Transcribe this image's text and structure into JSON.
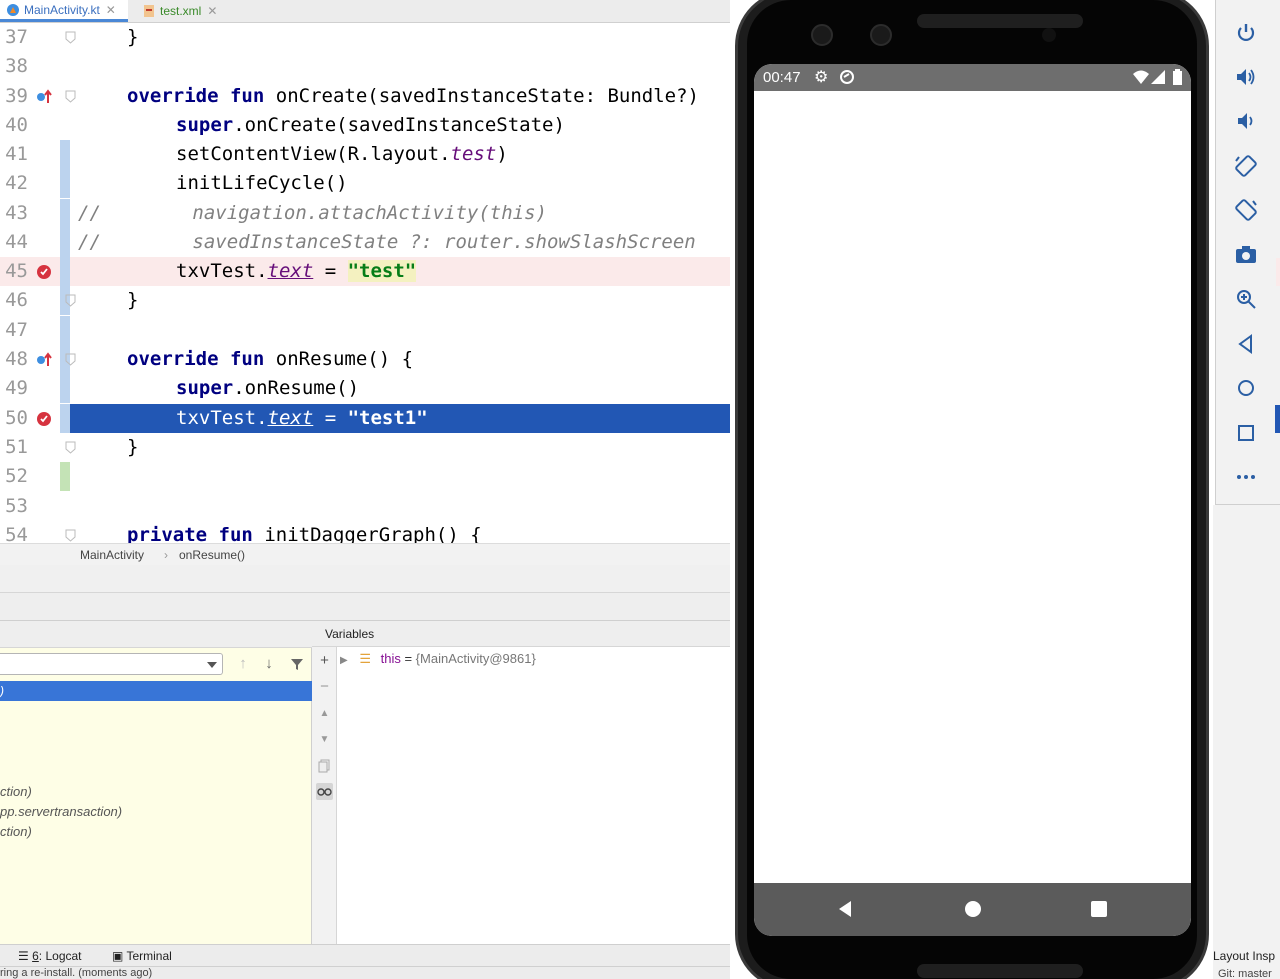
{
  "tabs": [
    {
      "label": "MainActivity.kt",
      "active": true
    },
    {
      "label": "test.xml",
      "active": false
    }
  ],
  "editor": {
    "lines": [
      {
        "n": "37"
      },
      {
        "n": "38"
      },
      {
        "n": "39"
      },
      {
        "n": "40"
      },
      {
        "n": "41"
      },
      {
        "n": "42"
      },
      {
        "n": "43"
      },
      {
        "n": "44"
      },
      {
        "n": "45"
      },
      {
        "n": "46"
      },
      {
        "n": "47"
      },
      {
        "n": "48"
      },
      {
        "n": "49"
      },
      {
        "n": "50"
      },
      {
        "n": "51"
      },
      {
        "n": "52"
      },
      {
        "n": "53"
      },
      {
        "n": "54"
      }
    ],
    "code": {
      "l37": "}",
      "l39_kw1": "override",
      "l39_kw2": "fun",
      "l39_rest": "onCreate(savedInstanceState: Bundle?)",
      "l40_kw": "super",
      "l40_rest": ".onCreate(savedInstanceState)",
      "l41_a": "setContentView(R.layout.",
      "l41_b": "test",
      "l41_c": ")",
      "l42": "initLifeCycle()",
      "l43": "//        navigation.attachActivity(this)",
      "l44": "//        savedInstanceState ?: router.showSlashScreen",
      "l45_a": "txvTest.",
      "l45_b": "text",
      "l45_c": " = ",
      "l45_d": "\"test\"",
      "l46": "}",
      "l48_kw1": "override",
      "l48_kw2": "fun",
      "l48_rest": "onResume() {",
      "l49_kw": "super",
      "l49_rest": ".onResume()",
      "l50_a": "txvTest.",
      "l50_b": "text",
      "l50_c": " = ",
      "l50_d": "\"test1\"",
      "l51": "}",
      "l54_kw1": "private",
      "l54_kw2": "fun",
      "l54_rest": "initDaggerGraph() {"
    }
  },
  "breadcrumb": {
    "class": "MainActivity",
    "method": "onResume()"
  },
  "debugger": {
    "variables_title": "Variables",
    "frames": [
      "ction)",
      "pp.servertransaction)",
      "ction)"
    ],
    "variable": {
      "name": "this",
      "eq": " = ",
      "value": "{MainActivity@9861}"
    }
  },
  "bottom_toolbar": {
    "logcat_num": "6",
    "logcat": ": Logcat",
    "terminal": "Terminal",
    "layout_inspector": "Layout Insp"
  },
  "status": {
    "left": "ring a re-install. (moments ago)",
    "git": "Git: master"
  },
  "phone": {
    "time": "00:47"
  },
  "colors": {
    "accent": "#2257b4",
    "breakpoint": "#d6333f",
    "string": "#067d17",
    "keyword": "#000080"
  },
  "icons": [
    "kotlin-file-icon",
    "xml-file-icon",
    "power-icon",
    "volume-up-icon",
    "volume-down-icon",
    "rotate-left-icon",
    "rotate-right-icon",
    "camera-icon",
    "zoom-icon",
    "back-icon",
    "home-icon",
    "overview-icon",
    "more-icon"
  ]
}
